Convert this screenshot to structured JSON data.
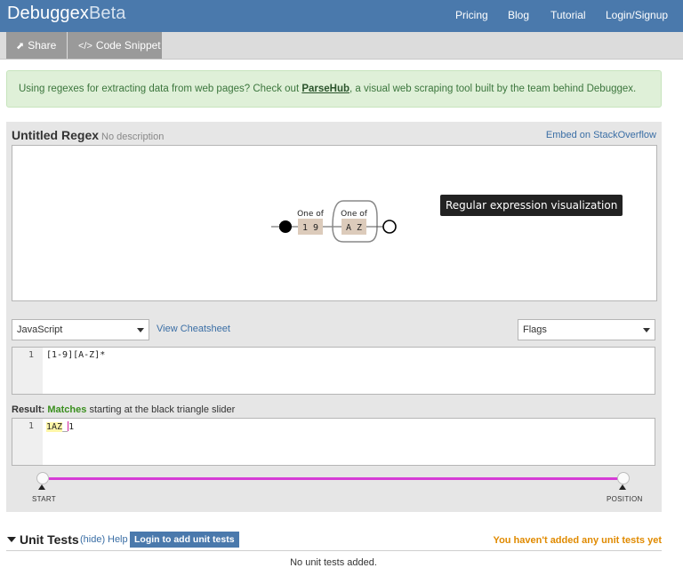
{
  "navbar": {
    "brand_main": "Debuggex",
    "brand_suffix": "Beta",
    "links": [
      "Pricing",
      "Blog",
      "Tutorial",
      "Login/Signup"
    ]
  },
  "subnav": {
    "share_label": "Share",
    "snippet_label": "Code Snippet"
  },
  "alert": {
    "text_before": "Using regexes for extracting data from web pages? Check out ",
    "link": "ParseHub",
    "text_after": ", a visual web scraping tool built by the team behind Debuggex."
  },
  "regex": {
    "title": "Untitled Regex",
    "description": "No description",
    "embed_link": "Embed on StackOverflow",
    "tooltip": "Regular expression visualization",
    "viz": {
      "group1_label": "One of",
      "group1_chars": "1 9",
      "group2_label": "One of",
      "group2_chars": "A Z"
    }
  },
  "controls": {
    "flavor": "JavaScript",
    "cheatsheet": "View Cheatsheet",
    "flags": "Flags"
  },
  "editor": {
    "line_number": "1",
    "pattern": "[1-9][A-Z]*"
  },
  "result": {
    "prefix": "Result:",
    "status": "Matches",
    "suffix": "starting at the black triangle slider",
    "line_number": "1",
    "match_text": "1AZ",
    "rest_before_cursor": "_",
    "rest_after_cursor": "1"
  },
  "slider": {
    "start_label": "START",
    "position_label": "POSITION"
  },
  "unit_tests": {
    "title": "Unit Tests",
    "hide": "(hide)",
    "help": "Help",
    "login_button": "Login to add unit tests",
    "warning": "You haven't added any unit tests yet",
    "empty": "No unit tests added."
  }
}
